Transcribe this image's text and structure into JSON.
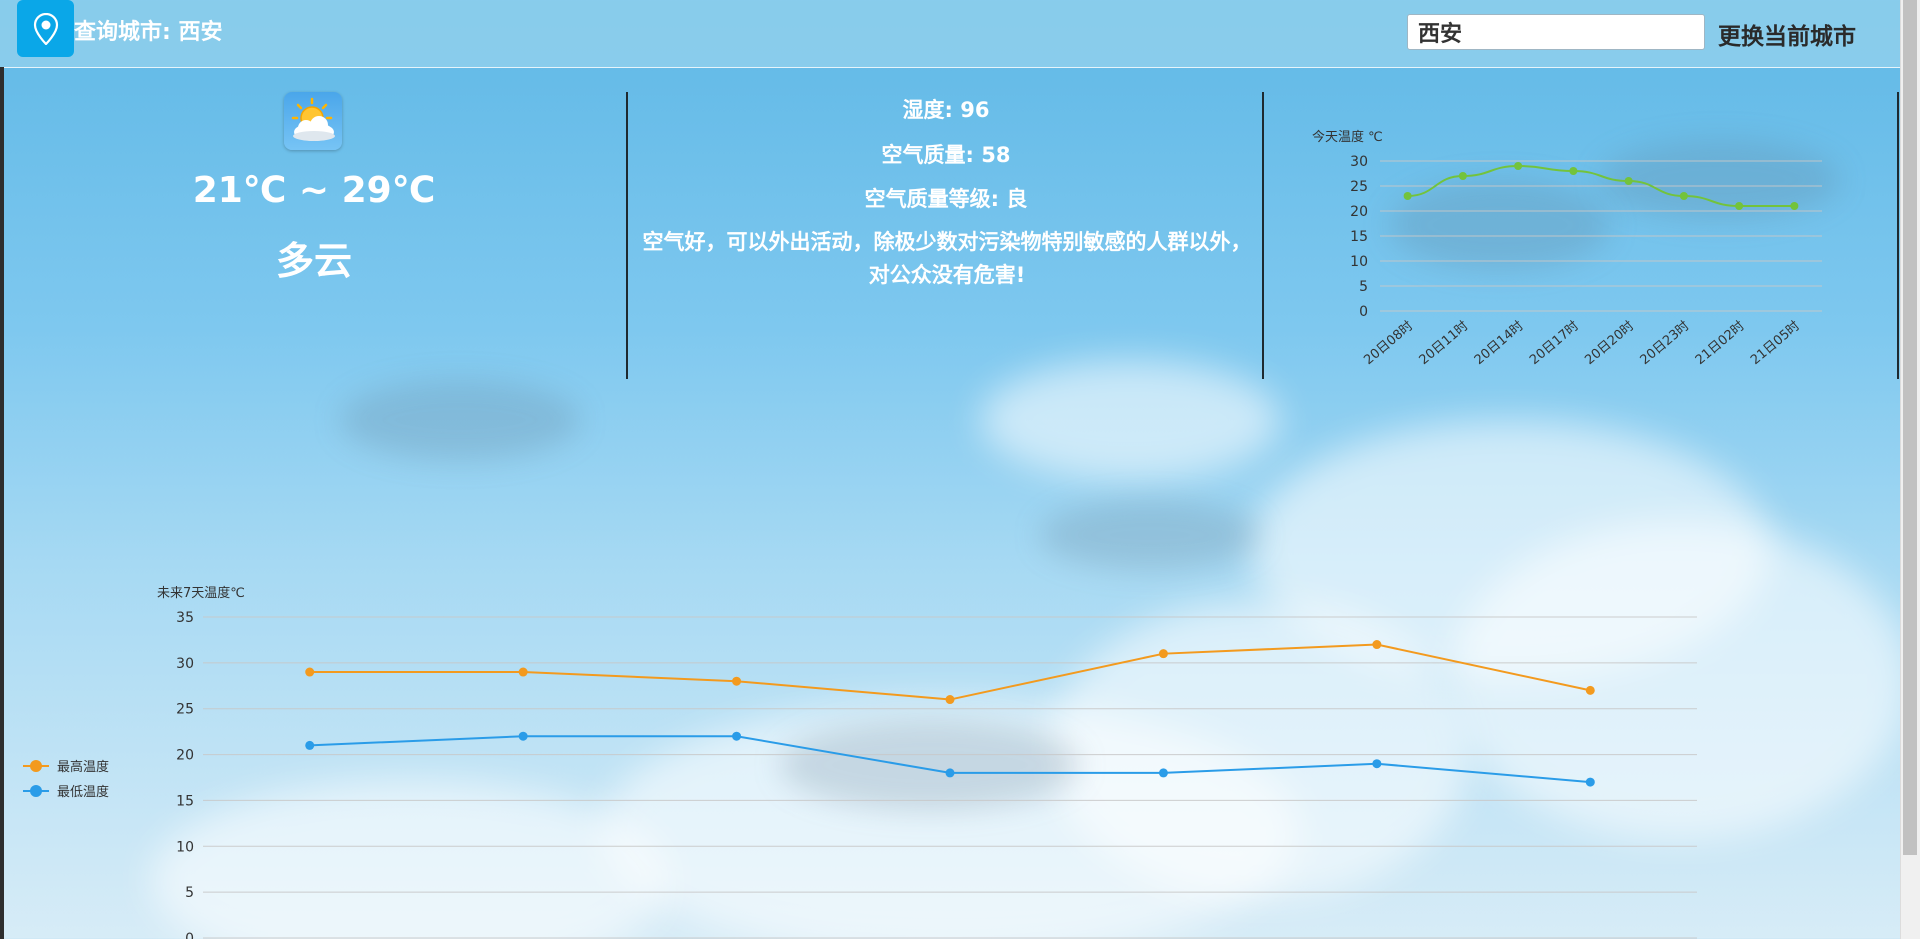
{
  "header": {
    "city_label": "查询城市: 西安",
    "search_value": "西安",
    "change_button": "更换当前城市"
  },
  "today": {
    "temp_range": "21℃ ~ 29℃",
    "weather": "多云",
    "icon": "partly-cloudy-icon"
  },
  "air": {
    "humidity": "湿度: 96",
    "aqi": "空气质量: 58",
    "level": "空气质量等级: 良",
    "advice": "空气好，可以外出活动，除极少数对污染物特别敏感的人群以外，对公众没有危害!"
  },
  "colors": {
    "today_line": "#73c33c",
    "max_line": "#f39a1e",
    "min_line": "#2a9ce8",
    "header_bg": "#8ccdeb",
    "location_button": "#0aa7e8"
  },
  "chart_data": [
    {
      "type": "line",
      "title": "今天温度 ℃",
      "categories": [
        "20日08时",
        "20日11时",
        "20日14时",
        "20日17时",
        "20日20时",
        "20日23时",
        "21日02时",
        "21日05时"
      ],
      "series": [
        {
          "values": [
            23,
            27,
            29,
            28,
            26,
            23,
            21,
            21
          ]
        }
      ],
      "ylim": [
        0,
        30
      ],
      "yticks": [
        0,
        5,
        10,
        15,
        20,
        25,
        30
      ],
      "grid": true
    },
    {
      "type": "line",
      "title": "未来7天温度℃",
      "legend_position": "left",
      "series": [
        {
          "name": "最高温度",
          "values": [
            29,
            29,
            28,
            26,
            31,
            32,
            27
          ]
        },
        {
          "name": "最低温度",
          "values": [
            21,
            22,
            22,
            18,
            18,
            19,
            17
          ]
        }
      ],
      "ylim": [
        0,
        35
      ],
      "yticks": [
        0,
        5,
        10,
        15,
        20,
        25,
        30,
        35
      ],
      "grid": true
    }
  ]
}
